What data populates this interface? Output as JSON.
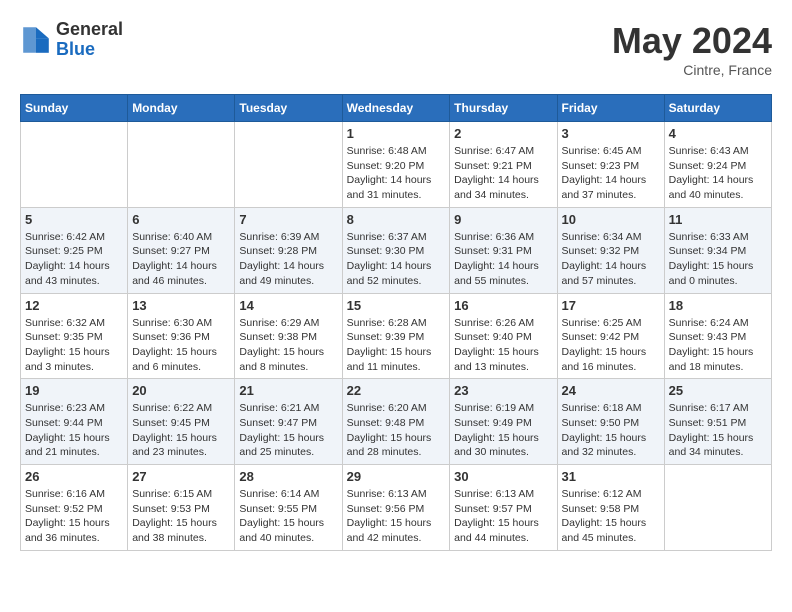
{
  "header": {
    "logo_general": "General",
    "logo_blue": "Blue",
    "month_year": "May 2024",
    "location": "Cintre, France"
  },
  "weekdays": [
    "Sunday",
    "Monday",
    "Tuesday",
    "Wednesday",
    "Thursday",
    "Friday",
    "Saturday"
  ],
  "weeks": [
    [
      {
        "day": "",
        "sunrise": "",
        "sunset": "",
        "daylight": ""
      },
      {
        "day": "",
        "sunrise": "",
        "sunset": "",
        "daylight": ""
      },
      {
        "day": "",
        "sunrise": "",
        "sunset": "",
        "daylight": ""
      },
      {
        "day": "1",
        "sunrise": "Sunrise: 6:48 AM",
        "sunset": "Sunset: 9:20 PM",
        "daylight": "Daylight: 14 hours and 31 minutes."
      },
      {
        "day": "2",
        "sunrise": "Sunrise: 6:47 AM",
        "sunset": "Sunset: 9:21 PM",
        "daylight": "Daylight: 14 hours and 34 minutes."
      },
      {
        "day": "3",
        "sunrise": "Sunrise: 6:45 AM",
        "sunset": "Sunset: 9:23 PM",
        "daylight": "Daylight: 14 hours and 37 minutes."
      },
      {
        "day": "4",
        "sunrise": "Sunrise: 6:43 AM",
        "sunset": "Sunset: 9:24 PM",
        "daylight": "Daylight: 14 hours and 40 minutes."
      }
    ],
    [
      {
        "day": "5",
        "sunrise": "Sunrise: 6:42 AM",
        "sunset": "Sunset: 9:25 PM",
        "daylight": "Daylight: 14 hours and 43 minutes."
      },
      {
        "day": "6",
        "sunrise": "Sunrise: 6:40 AM",
        "sunset": "Sunset: 9:27 PM",
        "daylight": "Daylight: 14 hours and 46 minutes."
      },
      {
        "day": "7",
        "sunrise": "Sunrise: 6:39 AM",
        "sunset": "Sunset: 9:28 PM",
        "daylight": "Daylight: 14 hours and 49 minutes."
      },
      {
        "day": "8",
        "sunrise": "Sunrise: 6:37 AM",
        "sunset": "Sunset: 9:30 PM",
        "daylight": "Daylight: 14 hours and 52 minutes."
      },
      {
        "day": "9",
        "sunrise": "Sunrise: 6:36 AM",
        "sunset": "Sunset: 9:31 PM",
        "daylight": "Daylight: 14 hours and 55 minutes."
      },
      {
        "day": "10",
        "sunrise": "Sunrise: 6:34 AM",
        "sunset": "Sunset: 9:32 PM",
        "daylight": "Daylight: 14 hours and 57 minutes."
      },
      {
        "day": "11",
        "sunrise": "Sunrise: 6:33 AM",
        "sunset": "Sunset: 9:34 PM",
        "daylight": "Daylight: 15 hours and 0 minutes."
      }
    ],
    [
      {
        "day": "12",
        "sunrise": "Sunrise: 6:32 AM",
        "sunset": "Sunset: 9:35 PM",
        "daylight": "Daylight: 15 hours and 3 minutes."
      },
      {
        "day": "13",
        "sunrise": "Sunrise: 6:30 AM",
        "sunset": "Sunset: 9:36 PM",
        "daylight": "Daylight: 15 hours and 6 minutes."
      },
      {
        "day": "14",
        "sunrise": "Sunrise: 6:29 AM",
        "sunset": "Sunset: 9:38 PM",
        "daylight": "Daylight: 15 hours and 8 minutes."
      },
      {
        "day": "15",
        "sunrise": "Sunrise: 6:28 AM",
        "sunset": "Sunset: 9:39 PM",
        "daylight": "Daylight: 15 hours and 11 minutes."
      },
      {
        "day": "16",
        "sunrise": "Sunrise: 6:26 AM",
        "sunset": "Sunset: 9:40 PM",
        "daylight": "Daylight: 15 hours and 13 minutes."
      },
      {
        "day": "17",
        "sunrise": "Sunrise: 6:25 AM",
        "sunset": "Sunset: 9:42 PM",
        "daylight": "Daylight: 15 hours and 16 minutes."
      },
      {
        "day": "18",
        "sunrise": "Sunrise: 6:24 AM",
        "sunset": "Sunset: 9:43 PM",
        "daylight": "Daylight: 15 hours and 18 minutes."
      }
    ],
    [
      {
        "day": "19",
        "sunrise": "Sunrise: 6:23 AM",
        "sunset": "Sunset: 9:44 PM",
        "daylight": "Daylight: 15 hours and 21 minutes."
      },
      {
        "day": "20",
        "sunrise": "Sunrise: 6:22 AM",
        "sunset": "Sunset: 9:45 PM",
        "daylight": "Daylight: 15 hours and 23 minutes."
      },
      {
        "day": "21",
        "sunrise": "Sunrise: 6:21 AM",
        "sunset": "Sunset: 9:47 PM",
        "daylight": "Daylight: 15 hours and 25 minutes."
      },
      {
        "day": "22",
        "sunrise": "Sunrise: 6:20 AM",
        "sunset": "Sunset: 9:48 PM",
        "daylight": "Daylight: 15 hours and 28 minutes."
      },
      {
        "day": "23",
        "sunrise": "Sunrise: 6:19 AM",
        "sunset": "Sunset: 9:49 PM",
        "daylight": "Daylight: 15 hours and 30 minutes."
      },
      {
        "day": "24",
        "sunrise": "Sunrise: 6:18 AM",
        "sunset": "Sunset: 9:50 PM",
        "daylight": "Daylight: 15 hours and 32 minutes."
      },
      {
        "day": "25",
        "sunrise": "Sunrise: 6:17 AM",
        "sunset": "Sunset: 9:51 PM",
        "daylight": "Daylight: 15 hours and 34 minutes."
      }
    ],
    [
      {
        "day": "26",
        "sunrise": "Sunrise: 6:16 AM",
        "sunset": "Sunset: 9:52 PM",
        "daylight": "Daylight: 15 hours and 36 minutes."
      },
      {
        "day": "27",
        "sunrise": "Sunrise: 6:15 AM",
        "sunset": "Sunset: 9:53 PM",
        "daylight": "Daylight: 15 hours and 38 minutes."
      },
      {
        "day": "28",
        "sunrise": "Sunrise: 6:14 AM",
        "sunset": "Sunset: 9:55 PM",
        "daylight": "Daylight: 15 hours and 40 minutes."
      },
      {
        "day": "29",
        "sunrise": "Sunrise: 6:13 AM",
        "sunset": "Sunset: 9:56 PM",
        "daylight": "Daylight: 15 hours and 42 minutes."
      },
      {
        "day": "30",
        "sunrise": "Sunrise: 6:13 AM",
        "sunset": "Sunset: 9:57 PM",
        "daylight": "Daylight: 15 hours and 44 minutes."
      },
      {
        "day": "31",
        "sunrise": "Sunrise: 6:12 AM",
        "sunset": "Sunset: 9:58 PM",
        "daylight": "Daylight: 15 hours and 45 minutes."
      },
      {
        "day": "",
        "sunrise": "",
        "sunset": "",
        "daylight": ""
      }
    ]
  ]
}
